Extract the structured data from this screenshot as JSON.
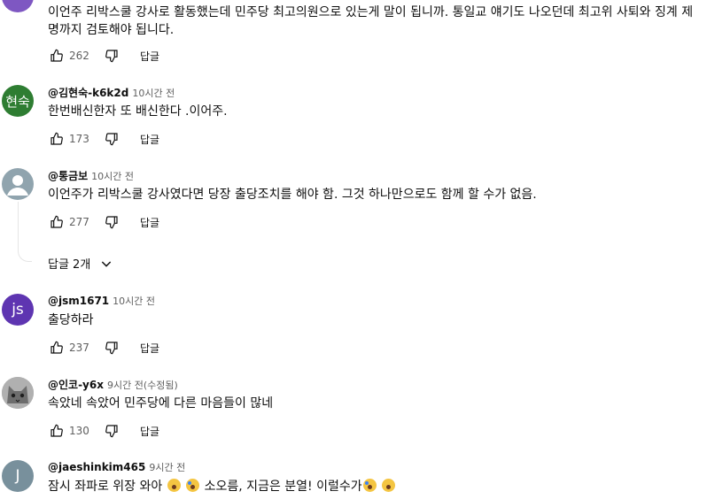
{
  "labels": {
    "reply": "답글"
  },
  "comments": [
    {
      "text": "이언주 리박스쿨 강사로 활동했는데 민주당 최고의원으로 있는게 말이 됩니까. 통일교 얘기도 나오던데 최고위 사퇴와 징계 제명까지 검토해야 됩니다.",
      "likes": "262"
    },
    {
      "avatar_text": "현숙",
      "avatar_color": "#2e7d32",
      "author": "@김현숙-k6k2d",
      "time": "10시간 전",
      "text": "한번배신한자 또 배신한다 .이어주.",
      "likes": "173"
    },
    {
      "avatar_color": "#90a4ae",
      "author": "@통금보",
      "time": "10시간 전",
      "text": "이언주가 리박스쿨 강사였다면 당장 출당조치를 해야 함. 그것 하나만으로도 함께 할 수가 없음.",
      "likes": "277",
      "replies_label": "답글 2개"
    },
    {
      "avatar_text": "js",
      "avatar_color": "#5e35b1",
      "author": "@jsm1671",
      "time": "10시간 전",
      "text": "출당하라",
      "likes": "237"
    },
    {
      "avatar_color": "#8d8d8d",
      "author": "@인코-y6x",
      "time": "9시간 전(수정됨)",
      "text": "속았네 속았어 민주당에 다른 마음들이 많네",
      "likes": "130"
    },
    {
      "avatar_text": "J",
      "avatar_color": "#78909c",
      "author": "@jaeshinkim465",
      "time": "9시간 전",
      "text_a": "잠시 좌파로 위장 와아",
      "text_b": "소오름, 지금은 분열! 이럴수가"
    }
  ]
}
